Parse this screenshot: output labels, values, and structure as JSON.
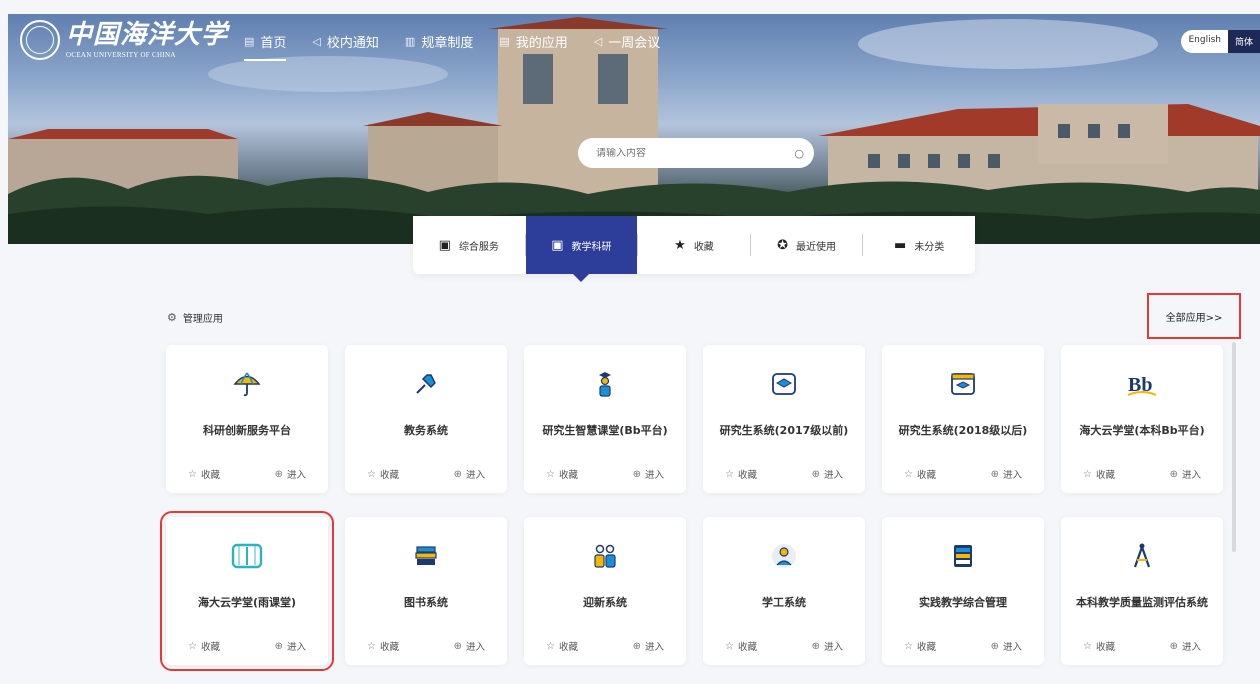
{
  "header": {
    "logo_cn": "中国海洋大学",
    "logo_en": "OCEAN UNIVERSITY OF CHINA",
    "nav": [
      {
        "label": "首页",
        "icon": "home-icon",
        "glyph": "▤"
      },
      {
        "label": "校内通知",
        "icon": "megaphone-icon",
        "glyph": "◁"
      },
      {
        "label": "规章制度",
        "icon": "rules-icon",
        "glyph": "▥"
      },
      {
        "label": "我的应用",
        "icon": "apps-icon",
        "glyph": "▤"
      },
      {
        "label": "一周会议",
        "icon": "meeting-icon",
        "glyph": "◁"
      }
    ],
    "lang_en": "English",
    "lang_zh": "简体"
  },
  "search": {
    "placeholder": "请输入内容"
  },
  "tabs": [
    {
      "label": "综合服务",
      "icon": "image-icon",
      "glyph": "▣"
    },
    {
      "label": "教学科研",
      "icon": "image-icon",
      "glyph": "▣"
    },
    {
      "label": "收藏",
      "icon": "star-icon",
      "glyph": "★"
    },
    {
      "label": "最近使用",
      "icon": "compass-icon",
      "glyph": "✪"
    },
    {
      "label": "未分类",
      "icon": "briefcase-icon",
      "glyph": "▬"
    }
  ],
  "manage_label": "管理应用",
  "all_apps_label": "全部应用>>",
  "card_actions": {
    "favorite": "收藏",
    "enter": "进入"
  },
  "apps": [
    {
      "name": "科研创新服务平台",
      "icon": "umbrella-icon"
    },
    {
      "name": "教务系统",
      "icon": "pushpin-icon"
    },
    {
      "name": "研究生智慧课堂(Bb平台)",
      "icon": "graduate-icon"
    },
    {
      "name": "研究生系统(2017级以前)",
      "icon": "mortarboard-icon"
    },
    {
      "name": "研究生系统(2018级以后)",
      "icon": "mortarboard-screen-icon"
    },
    {
      "name": "海大云学堂(本科Bb平台)",
      "icon": "blackboard-logo-icon"
    },
    {
      "name": "海大云学堂(雨课堂)",
      "icon": "book-icon"
    },
    {
      "name": "图书系统",
      "icon": "books-icon"
    },
    {
      "name": "迎新系统",
      "icon": "people-icon"
    },
    {
      "name": "学工系统",
      "icon": "student-icon"
    },
    {
      "name": "实践教学综合管理",
      "icon": "server-icon"
    },
    {
      "name": "本科教学质量监测评估系统",
      "icon": "compass-tool-icon"
    }
  ],
  "colors": {
    "accent": "#2d3e9a",
    "highlight": "#e53935",
    "icon_blue": "#1a8fd6",
    "icon_navy": "#1d3a6e",
    "icon_yellow": "#f5b800"
  }
}
